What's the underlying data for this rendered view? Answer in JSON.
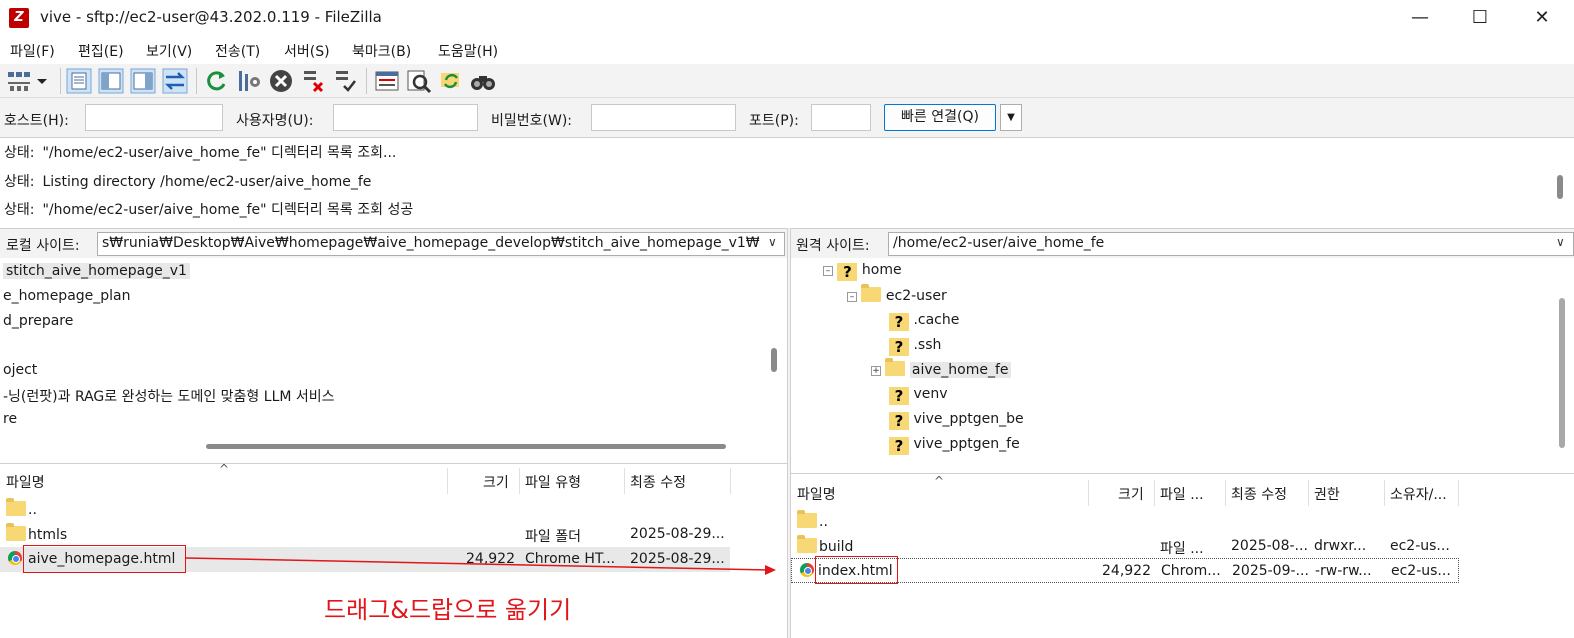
{
  "window": {
    "title": "vive - sftp://ec2-user@43.202.0.119 - FileZilla",
    "app_icon_glyph": "Z"
  },
  "menu": [
    "파일(F)",
    "편집(E)",
    "보기(V)",
    "전송(T)",
    "서버(S)",
    "북마크(B)",
    "도움말(H)"
  ],
  "quickconnect": {
    "host_label": "호스트(H):",
    "user_label": "사용자명(U):",
    "pass_label": "비밀번호(W):",
    "port_label": "포트(P):",
    "connect_button": "빠른 연결(Q)"
  },
  "log": [
    {
      "label": "상태:",
      "text": "\"/home/ec2-user/aive_home_fe\" 디렉터리 목록 조회..."
    },
    {
      "label": "상태:",
      "text": "Listing directory /home/ec2-user/aive_home_fe"
    },
    {
      "label": "상태:",
      "text": "\"/home/ec2-user/aive_home_fe\" 디렉터리 목록 조회 성공"
    }
  ],
  "local": {
    "site_label": "로컬 사이트:",
    "path": "s₩runia₩Desktop₩Aive₩homepage₩aive_homepage_develop₩stitch_aive_homepage_v1₩",
    "tree": [
      "stitch_aive_homepage_v1",
      "e_homepage_plan",
      "d_prepare",
      "oject",
      "-닝(런팟)과 RAG로 완성하는 도메인 맞춤형 LLM 서비스",
      "re"
    ],
    "columns": [
      "파일명",
      "크기",
      "파일 유형",
      "최종 수정"
    ],
    "files": [
      {
        "name": "..",
        "size": "",
        "type": "",
        "modified": ""
      },
      {
        "name": "htmls",
        "size": "",
        "type": "파일 폴더",
        "modified": "2025-08-29..."
      },
      {
        "name": "aive_homepage.html",
        "size": "24,922",
        "type": "Chrome HT...",
        "modified": "2025-08-29..."
      }
    ]
  },
  "remote": {
    "site_label": "원격 사이트:",
    "path": "/home/ec2-user/aive_home_fe",
    "tree": [
      "home",
      "ec2-user",
      ".cache",
      ".ssh",
      "aive_home_fe",
      "venv",
      "vive_pptgen_be",
      "vive_pptgen_fe"
    ],
    "columns": [
      "파일명",
      "크기",
      "파일 ...",
      "최종 수정",
      "권한",
      "소유자/..."
    ],
    "files": [
      {
        "name": "..",
        "size": "",
        "type": "",
        "modified": "",
        "perm": "",
        "owner": ""
      },
      {
        "name": "build",
        "size": "",
        "type": "파일 ...",
        "modified": "2025-08-...",
        "perm": "drwxr...",
        "owner": "ec2-us..."
      },
      {
        "name": "index.html",
        "size": "24,922",
        "type": "Chrom...",
        "modified": "2025-09-...",
        "perm": "-rw-rw...",
        "owner": "ec2-us..."
      }
    ]
  },
  "annotation": "드래그&드랍으로 옮기기",
  "colors": {
    "annotation": "#e0161b",
    "accent": "#0078d4"
  }
}
